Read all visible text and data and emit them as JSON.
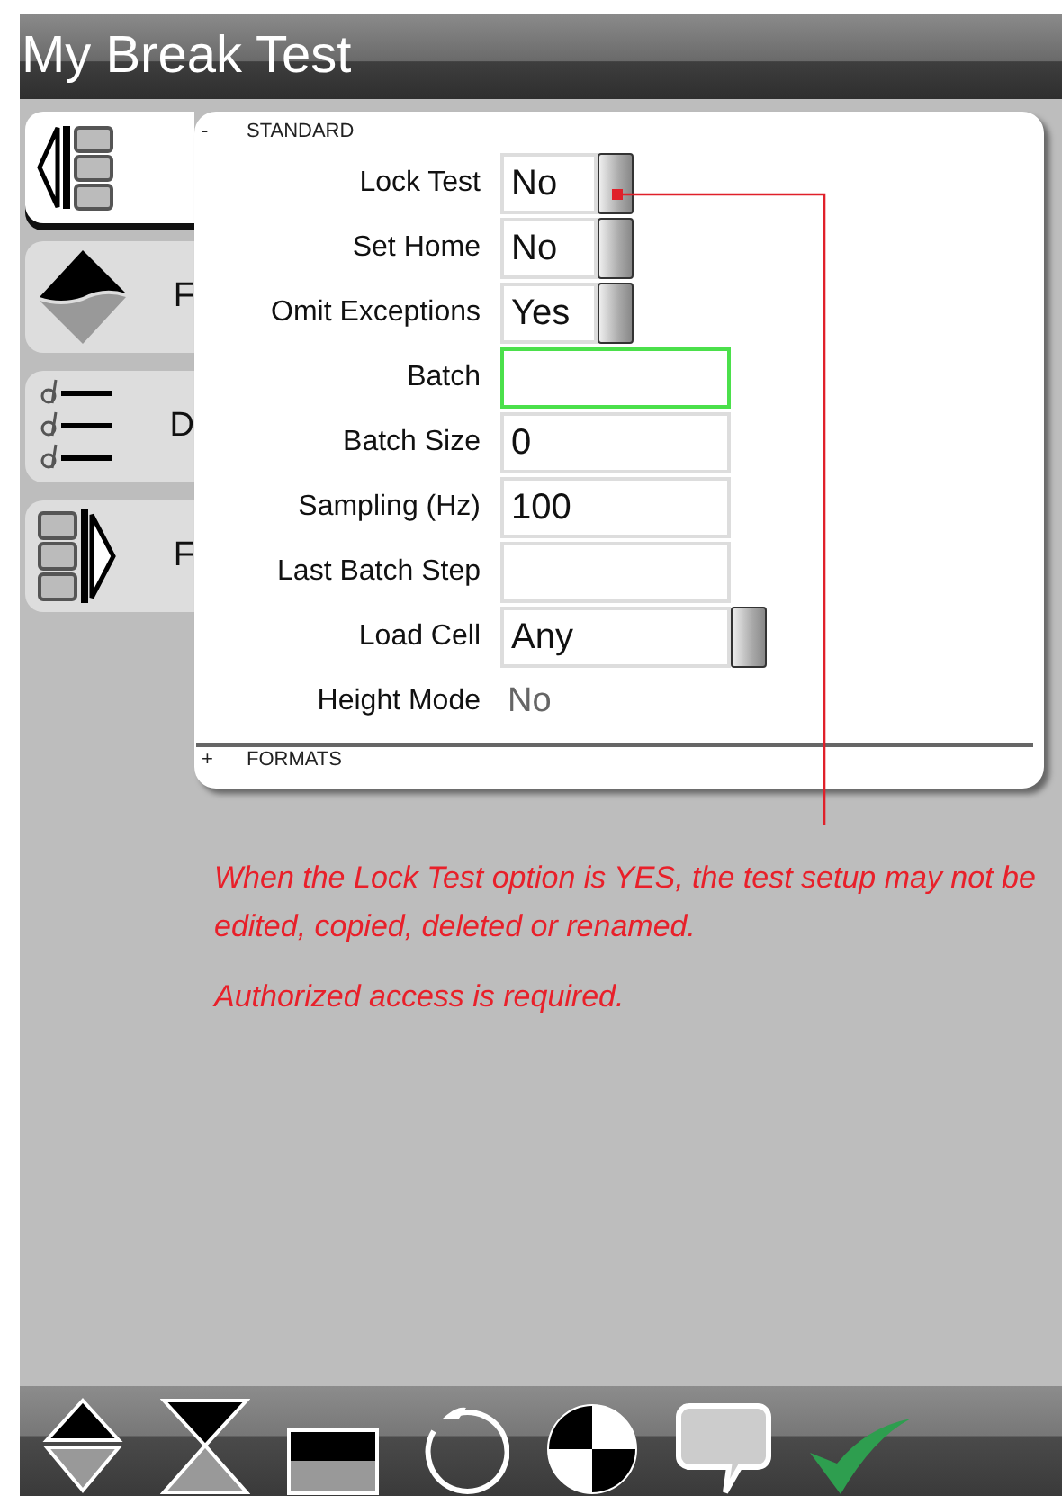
{
  "window": {
    "title": "My Break Test"
  },
  "sidebar": {
    "tabs": [
      {
        "selected": true
      },
      {
        "label": "F",
        "selected": false
      },
      {
        "label": "D",
        "selected": false
      },
      {
        "label": "F",
        "selected": false
      }
    ]
  },
  "panel": {
    "sections": [
      {
        "toggle": "-",
        "title": "STANDARD",
        "expanded": true,
        "rows": [
          {
            "label": "Lock Test",
            "kind": "dropdown",
            "value": "No",
            "focused": false
          },
          {
            "label": "Set Home",
            "kind": "dropdown",
            "value": "No",
            "focused": false
          },
          {
            "label": "Omit Exceptions",
            "kind": "dropdown",
            "value": "Yes",
            "focused": false
          },
          {
            "label": "Batch",
            "kind": "text",
            "value": "",
            "focused": true
          },
          {
            "label": "Batch Size",
            "kind": "text",
            "value": "0",
            "focused": false
          },
          {
            "label": "Sampling (Hz)",
            "kind": "text",
            "value": "100",
            "focused": false
          },
          {
            "label": "Last Batch Step",
            "kind": "text",
            "value": "",
            "focused": false
          },
          {
            "label": "Load Cell",
            "kind": "wide-dropdown",
            "value": "Any",
            "focused": false
          },
          {
            "label": "Height Mode",
            "kind": "readonly",
            "value": "No",
            "focused": false
          }
        ]
      },
      {
        "toggle": "+",
        "title": "FORMATS",
        "expanded": false
      }
    ]
  },
  "notes": [
    "When the Lock Test option is YES, the test setup may not be edited, copied, deleted or renamed.",
    "Authorized access is required."
  ]
}
